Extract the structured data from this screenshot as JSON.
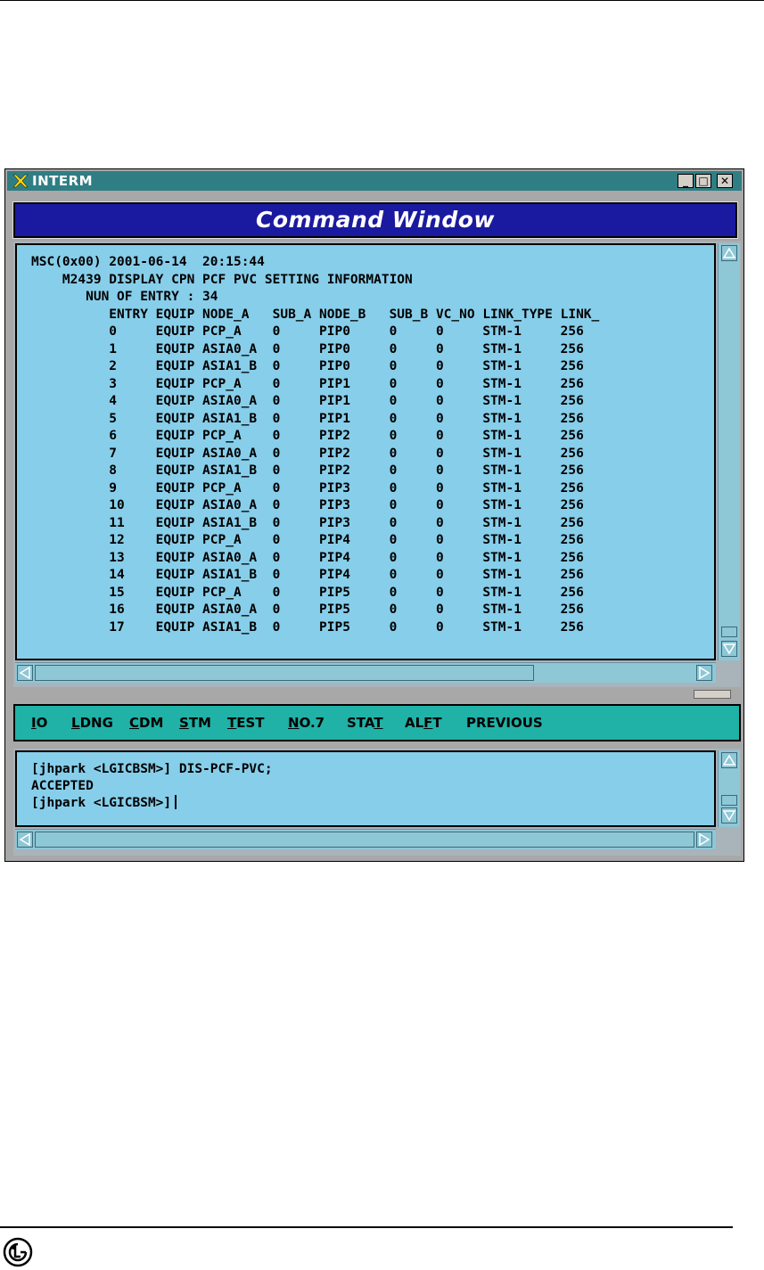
{
  "window": {
    "title": "INTERM",
    "controls": {
      "minimize": "_",
      "maximize": "□",
      "close": "✕"
    }
  },
  "command_window": {
    "title": "Command Window"
  },
  "output": {
    "header_lines": [
      "MSC(0x00) 2001-06-14  20:15:44",
      "    M2439 DISPLAY CPN PCF PVC SETTING INFORMATION",
      "       NUN OF ENTRY : 34"
    ],
    "columns": [
      "ENTRY",
      "EQUIP",
      "NODE_A",
      "SUB_A",
      "NODE_B",
      "SUB_B",
      "VC_NO",
      "LINK_TYPE",
      "LINK_"
    ],
    "rows": [
      [
        "0",
        "EQUIP",
        "PCP_A",
        "0",
        "PIP0",
        "0",
        "0",
        "STM-1",
        "256"
      ],
      [
        "1",
        "EQUIP",
        "ASIA0_A",
        "0",
        "PIP0",
        "0",
        "0",
        "STM-1",
        "256"
      ],
      [
        "2",
        "EQUIP",
        "ASIA1_B",
        "0",
        "PIP0",
        "0",
        "0",
        "STM-1",
        "256"
      ],
      [
        "3",
        "EQUIP",
        "PCP_A",
        "0",
        "PIP1",
        "0",
        "0",
        "STM-1",
        "256"
      ],
      [
        "4",
        "EQUIP",
        "ASIA0_A",
        "0",
        "PIP1",
        "0",
        "0",
        "STM-1",
        "256"
      ],
      [
        "5",
        "EQUIP",
        "ASIA1_B",
        "0",
        "PIP1",
        "0",
        "0",
        "STM-1",
        "256"
      ],
      [
        "6",
        "EQUIP",
        "PCP_A",
        "0",
        "PIP2",
        "0",
        "0",
        "STM-1",
        "256"
      ],
      [
        "7",
        "EQUIP",
        "ASIA0_A",
        "0",
        "PIP2",
        "0",
        "0",
        "STM-1",
        "256"
      ],
      [
        "8",
        "EQUIP",
        "ASIA1_B",
        "0",
        "PIP2",
        "0",
        "0",
        "STM-1",
        "256"
      ],
      [
        "9",
        "EQUIP",
        "PCP_A",
        "0",
        "PIP3",
        "0",
        "0",
        "STM-1",
        "256"
      ],
      [
        "10",
        "EQUIP",
        "ASIA0_A",
        "0",
        "PIP3",
        "0",
        "0",
        "STM-1",
        "256"
      ],
      [
        "11",
        "EQUIP",
        "ASIA1_B",
        "0",
        "PIP3",
        "0",
        "0",
        "STM-1",
        "256"
      ],
      [
        "12",
        "EQUIP",
        "PCP_A",
        "0",
        "PIP4",
        "0",
        "0",
        "STM-1",
        "256"
      ],
      [
        "13",
        "EQUIP",
        "ASIA0_A",
        "0",
        "PIP4",
        "0",
        "0",
        "STM-1",
        "256"
      ],
      [
        "14",
        "EQUIP",
        "ASIA1_B",
        "0",
        "PIP4",
        "0",
        "0",
        "STM-1",
        "256"
      ],
      [
        "15",
        "EQUIP",
        "PCP_A",
        "0",
        "PIP5",
        "0",
        "0",
        "STM-1",
        "256"
      ],
      [
        "16",
        "EQUIP",
        "ASIA0_A",
        "0",
        "PIP5",
        "0",
        "0",
        "STM-1",
        "256"
      ],
      [
        "17",
        "EQUIP",
        "ASIA1_B",
        "0",
        "PIP5",
        "0",
        "0",
        "STM-1",
        "256"
      ]
    ]
  },
  "menu": [
    {
      "pre": "",
      "ul": "I",
      "post": "O"
    },
    {
      "pre": "",
      "ul": "L",
      "post": "DNG"
    },
    {
      "pre": "",
      "ul": "C",
      "post": "DM"
    },
    {
      "pre": "",
      "ul": "S",
      "post": "TM"
    },
    {
      "pre": "",
      "ul": "T",
      "post": "EST"
    },
    {
      "pre": "",
      "ul": "N",
      "post": "O.7"
    },
    {
      "pre": "STA",
      "ul": "T",
      "post": ""
    },
    {
      "pre": "AL",
      "ul": "F",
      "post": "T"
    },
    {
      "pre": "PREVIOUS",
      "ul": "",
      "post": ""
    }
  ],
  "input": {
    "lines": [
      "[jhpark <LGICBSM>] DIS-PCF-PVC;",
      "ACCEPTED",
      "[jhpark <LGICBSM>]"
    ]
  },
  "colors": {
    "titlebar": "#2f7e83",
    "header_blue": "#1a1aa0",
    "pane_bg": "#87ceea",
    "menubar": "#20b2a7"
  }
}
